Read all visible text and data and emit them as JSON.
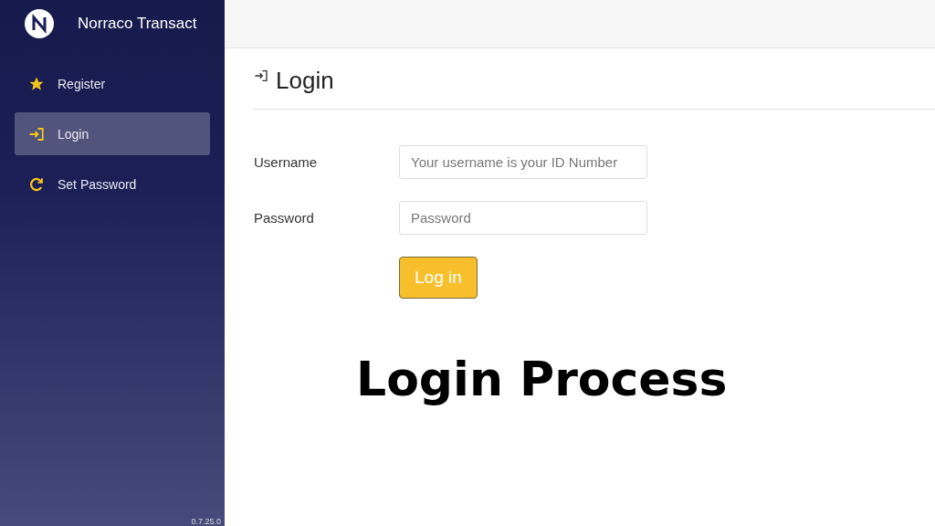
{
  "sidebar": {
    "brand": "Norraco Transact",
    "items": [
      {
        "label": "Register",
        "selected": false
      },
      {
        "label": "Login",
        "selected": true
      },
      {
        "label": "Set Password",
        "selected": false
      }
    ],
    "version": "0.7.25.0"
  },
  "page": {
    "title": "Login",
    "fields": [
      {
        "label": "Username",
        "placeholder": "Your username is your ID Number"
      },
      {
        "label": "Password",
        "placeholder": "Password"
      }
    ],
    "submit": "Log in"
  },
  "caption": "Login Process"
}
